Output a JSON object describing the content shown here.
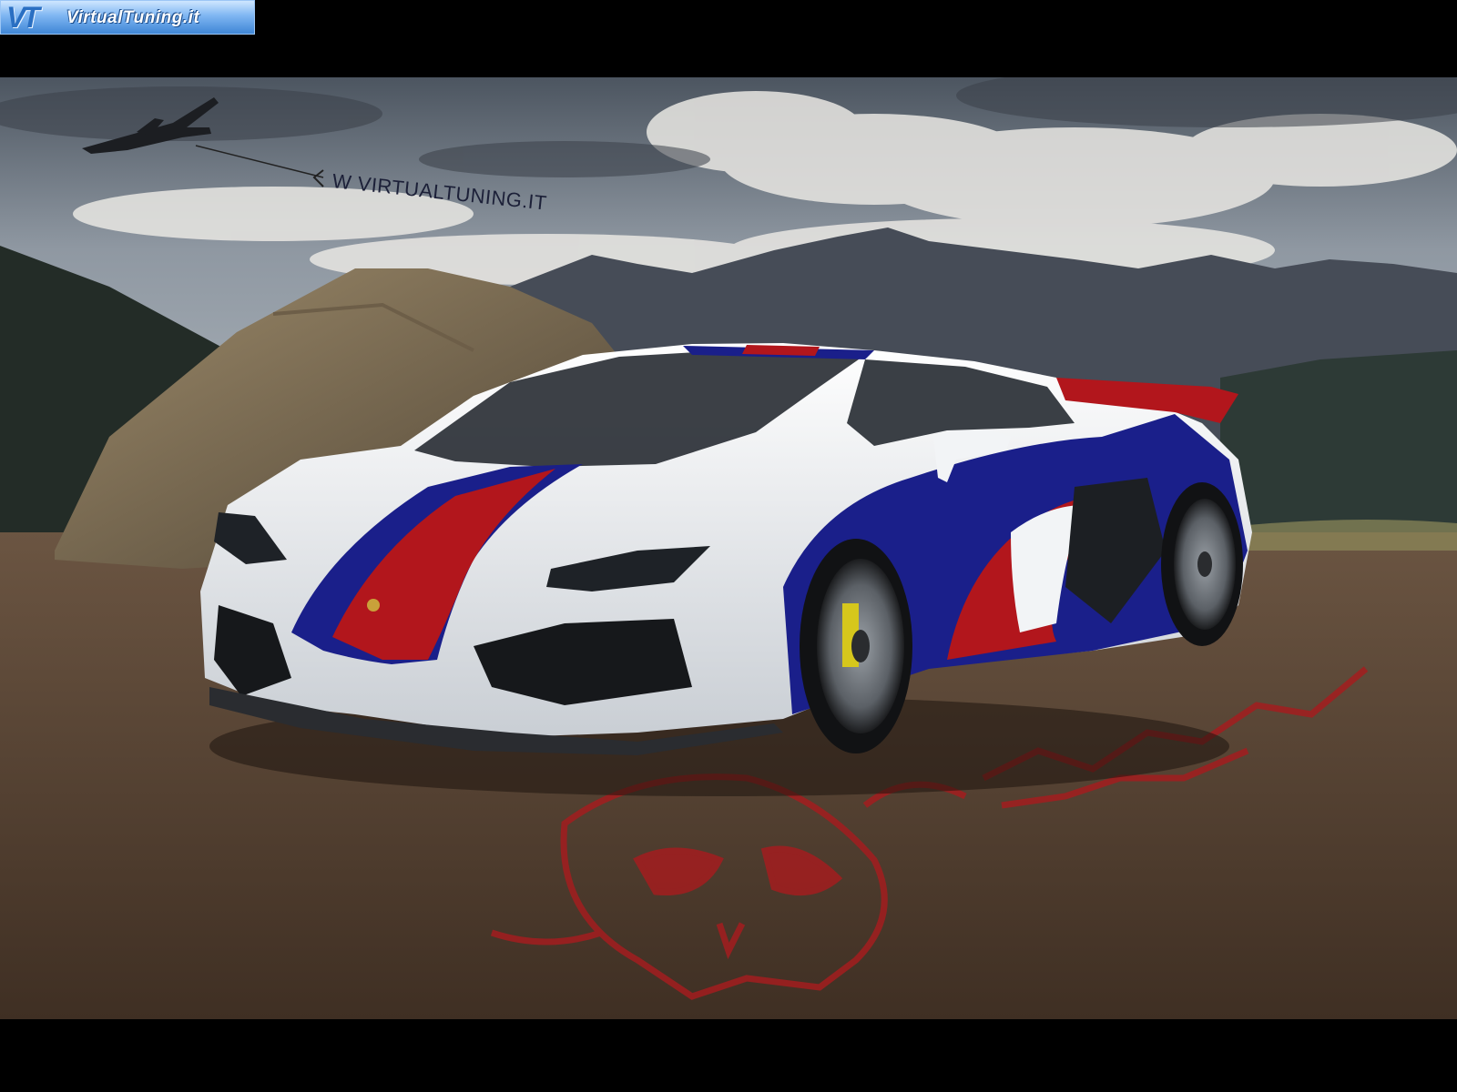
{
  "logo": {
    "mark": "VT",
    "text": "VirtualTuning.it"
  },
  "banner": {
    "text": "W VIRTUALTUNING.IT"
  },
  "colors": {
    "sky": "#6f7a86",
    "mountains": "#3d434d",
    "ground": "#5a4432",
    "car_body": "#f2f4f6",
    "stripe_blue": "#1a1f8a",
    "stripe_red": "#b2161c",
    "watermark_red": "#a31d1f"
  },
  "icons": [
    "airplane-icon",
    "skull-graffiti-icon",
    "car-emblem-icon"
  ]
}
